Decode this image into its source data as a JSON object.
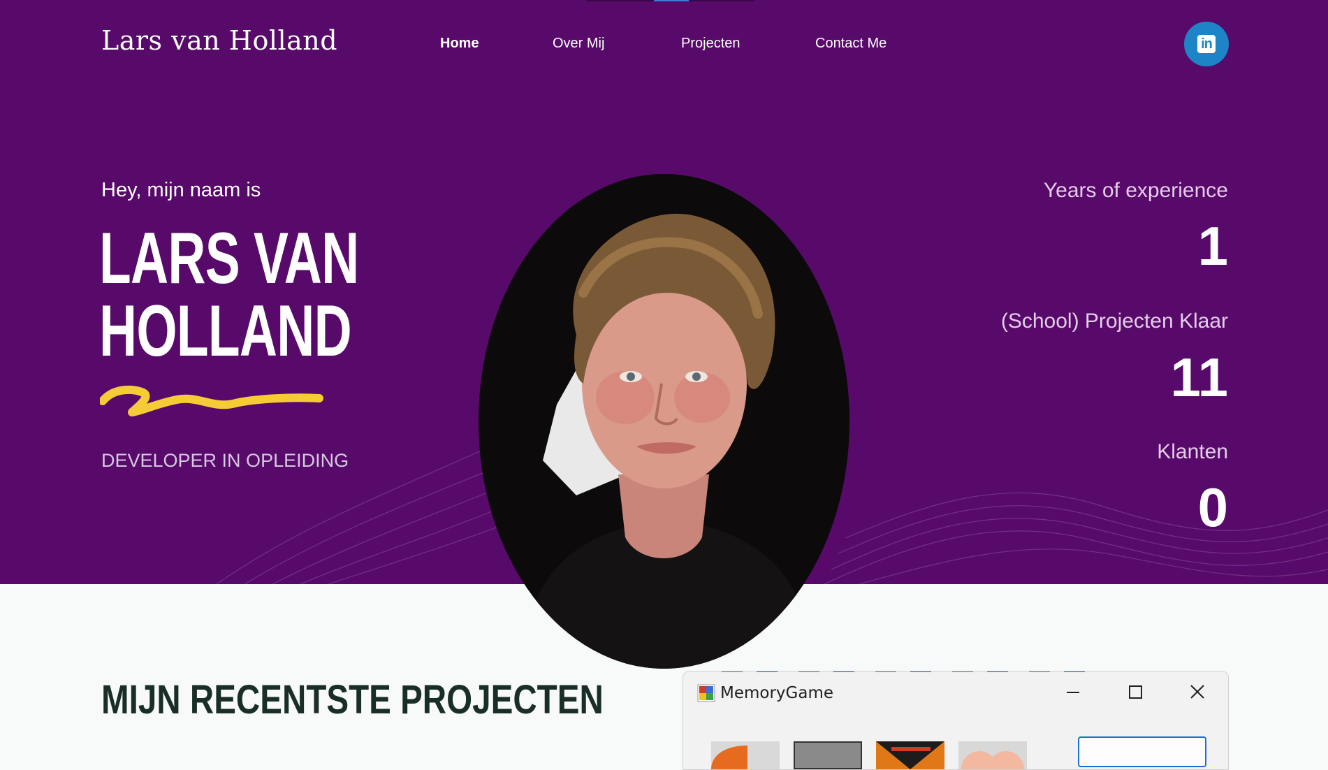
{
  "header": {
    "logo": "Lars van Holland",
    "nav": [
      {
        "label": "Home"
      },
      {
        "label": "Over Mij"
      },
      {
        "label": "Projecten"
      },
      {
        "label": "Contact Me"
      }
    ],
    "social_icon": "linkedin-icon",
    "social_label": "in"
  },
  "hero": {
    "greeting": "Hey, mijn naam is",
    "name_line1": "Lars van",
    "name_line2": "Holland",
    "role": "Developer in opleiding",
    "photo_icon": "profile-photo",
    "stats": [
      {
        "label": "Years of experience",
        "value": "1"
      },
      {
        "label": "(School) Projecten Klaar",
        "value": "11"
      },
      {
        "label": "Klanten",
        "value": "0"
      }
    ]
  },
  "projects": {
    "title": "Mijn recentste projecten",
    "window": {
      "title": "MemoryGame"
    }
  },
  "colors": {
    "hero_bg": "#580a6a",
    "accent_yellow": "#f5cc36",
    "linkedin_blue": "#1e84c8",
    "page_bg": "#f8faf9",
    "title_dark": "#1a2e28"
  }
}
